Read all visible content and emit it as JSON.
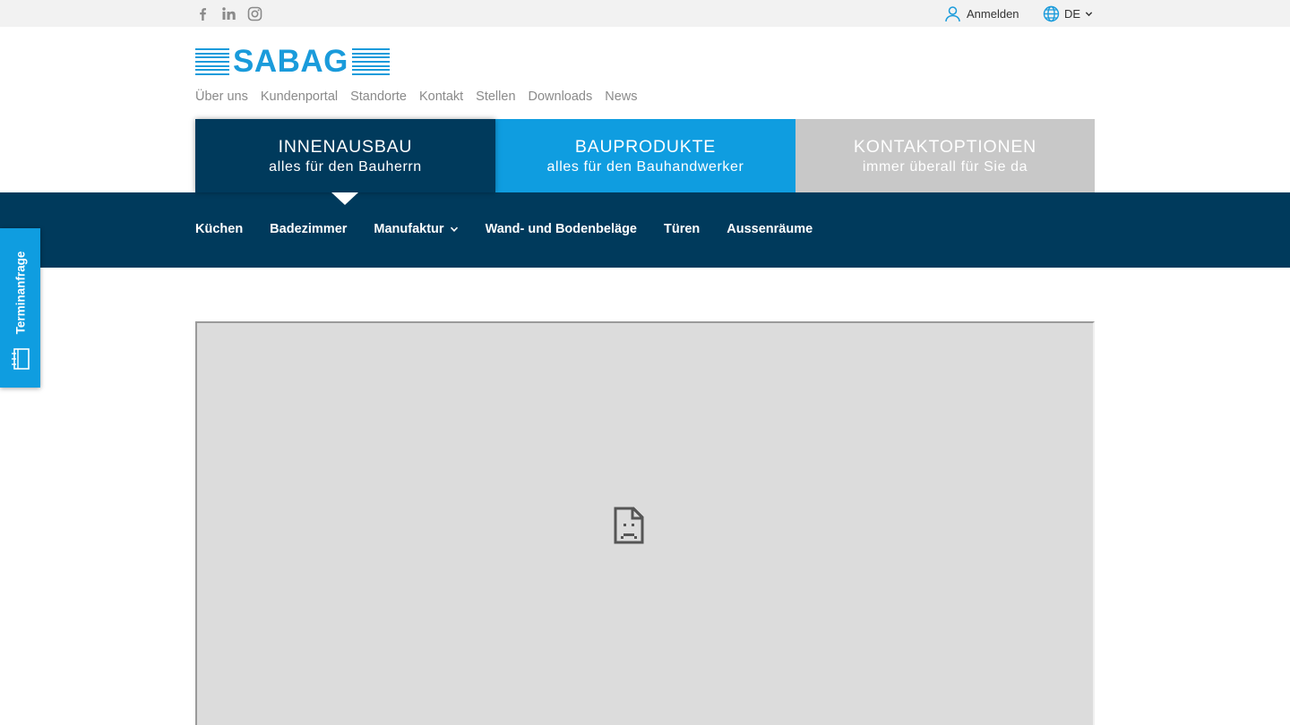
{
  "social": {
    "icons": [
      "facebook-icon",
      "linkedin-icon",
      "instagram-icon"
    ]
  },
  "account": {
    "login_label": "Anmelden",
    "icon": "user-icon"
  },
  "language": {
    "current": "DE",
    "icon": "globe-icon"
  },
  "logo": {
    "text": "SABAG",
    "color": "#1a9bdb"
  },
  "util_nav": {
    "items": [
      {
        "label": "Über uns"
      },
      {
        "label": "Kundenportal"
      },
      {
        "label": "Standorte"
      },
      {
        "label": "Kontakt"
      },
      {
        "label": "Stellen"
      },
      {
        "label": "Downloads"
      },
      {
        "label": "News"
      }
    ]
  },
  "sector_tabs": [
    {
      "title": "INNENAUSBAU",
      "subtitle": "alles für den Bauherrn",
      "active": true,
      "color": "#003a5c"
    },
    {
      "title": "BAUPRODUKTE",
      "subtitle": "alles für den Bauhandwerker",
      "active": false,
      "color": "#0f9de0"
    },
    {
      "title": "KONTAKTOPTIONEN",
      "subtitle": "immer überall für Sie da",
      "active": false,
      "color": "#c8c8c8"
    }
  ],
  "main_nav": {
    "items": [
      {
        "label": "Küchen"
      },
      {
        "label": "Badezimmer"
      },
      {
        "label": "Manufaktur",
        "has_dropdown": true
      },
      {
        "label": "Wand- und Bodenbeläge"
      },
      {
        "label": "Türen"
      },
      {
        "label": "Aussenräume"
      }
    ],
    "background": "#003a5c"
  },
  "side_tab": {
    "label": "Terminanfrage",
    "icon": "appointment-icon",
    "color": "#0f9de0"
  },
  "content": {
    "placeholder_icon": "broken-document-icon"
  }
}
